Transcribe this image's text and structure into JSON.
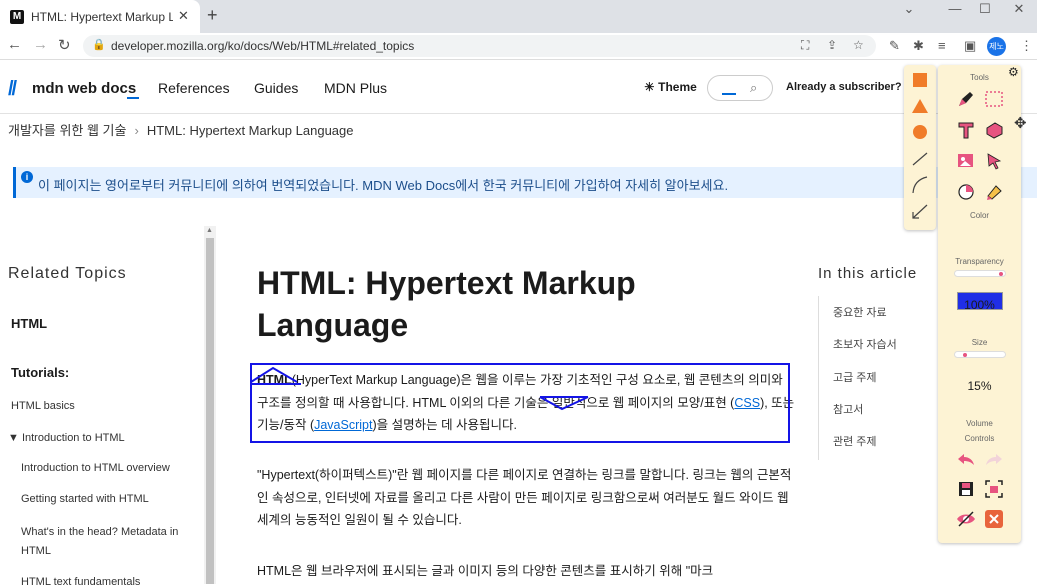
{
  "browser": {
    "tab_title": "HTML: Hypertext Markup Langu",
    "tab_favicon": "M",
    "url": "developer.mozilla.org/ko/docs/Web/HTML#related_topics",
    "profile_initials": "제노"
  },
  "header": {
    "logo_mark": "M",
    "logo_text": "mdn web docs",
    "nav": [
      "References",
      "Guides",
      "MDN Plus"
    ],
    "theme_label": "Theme",
    "subscriber_text": "Already a subscriber?"
  },
  "breadcrumb": {
    "items": [
      "개발자를 위한 웹 기술",
      "HTML: Hypertext Markup Language"
    ]
  },
  "notice": {
    "text": "이 페이지는 영어로부터 커뮤니티에 의하여 번역되었습니다. MDN Web Docs에서 한국 커뮤니티에 가입하여 자세히 알아보세요."
  },
  "sidebar": {
    "title": "Related Topics",
    "items": [
      {
        "label": "HTML"
      },
      {
        "label": "Tutorials:"
      },
      {
        "label": "HTML basics"
      },
      {
        "label": "▼ Introduction to HTML"
      },
      {
        "label": "Introduction to HTML overview"
      },
      {
        "label": "Getting started with HTML"
      },
      {
        "label": "What's in the head? Metadata in"
      },
      {
        "label": "HTML"
      },
      {
        "label": "HTML text fundamentals"
      }
    ]
  },
  "article": {
    "title_line1": "HTML: Hypertext Markup",
    "title_line2": "Language",
    "p1_bold": "HTML",
    "p1_a": "(HyperText Markup Language)은 웹을 이루는 가장 기초적인 구성 요소로, 웹 콘텐츠의 의미와 구조를 정의할 때 사용합니다. HTML 이외의 다른 기술은 일반적으로 웹 페이지의 모양/표현 (",
    "p1_link1": "CSS",
    "p1_b": "), 또는 기능/동작 (",
    "p1_link2": "JavaScript",
    "p1_c": ")을 설명하는 데 사용됩니다.",
    "p2": "\"Hypertext(하이퍼텍스트)\"란 웹 페이지를 다른 페이지로 연결하는 링크를 말합니다. 링크는 웹의 근본적인 속성으로, 인터넷에 자료를 올리고 다른 사람이 만든 페이지로 링크함으로써 여러분도 월드 와이드 웹 세계의 능동적인 일원이 될 수 있습니다.",
    "p3": "HTML은 웹 브라우저에 표시되는 글과 이미지 등의 다양한 콘텐츠를 표시하기 위해 \"마크"
  },
  "toc": {
    "title": "In this article",
    "items": [
      "중요한 자료",
      "초보자 자습서",
      "고급 주제",
      "참고서",
      "관련 주제"
    ]
  },
  "draw_toolbar": {
    "tools_label": "Tools",
    "color_label": "Color",
    "color_value": "#1f2ee6",
    "transparency_label": "Transparency",
    "transparency_value": "100%",
    "transparency_level": 1.0,
    "size_label": "Size",
    "size_value": "15%",
    "size_level": 0.15,
    "volume_label": "Volume",
    "controls_label": "Controls"
  }
}
